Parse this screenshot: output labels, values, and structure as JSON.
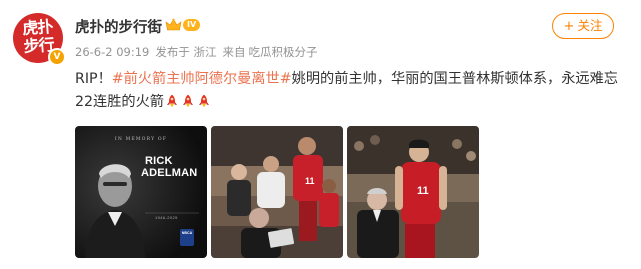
{
  "author": {
    "name": "虎扑的步行街",
    "avatar_text": "虎扑\n步行",
    "avatar_badge": "V",
    "vip_level": "IV"
  },
  "meta": {
    "date": "26-6-2 09:19",
    "location": "发布于 浙江",
    "source_prefix": "来自",
    "source_name": "吃瓜积极分子"
  },
  "follow_button": {
    "label": "关注",
    "plus": "+"
  },
  "post": {
    "prefix": "RIP！",
    "topic": "#前火箭主帅阿德尔曼离世#",
    "body": "姚明的前主帅，华丽的国王普林斯顿体系，永远难忘22连胜的火箭",
    "rocket_count": 3
  },
  "images": {
    "img1": {
      "memory_title": "IN MEMORY OF",
      "first_name": "RICK",
      "last_name": "ADELMAN",
      "years": "1946-2025",
      "badge_top": "NBCA"
    },
    "img2": {
      "jersey": "11"
    },
    "img3": {
      "jersey": "11"
    }
  },
  "colors": {
    "accent": "#ff8200",
    "topic": "#eb7350",
    "meta": "#939393",
    "text": "#333333",
    "avatar_bg": "#d52a2a"
  }
}
